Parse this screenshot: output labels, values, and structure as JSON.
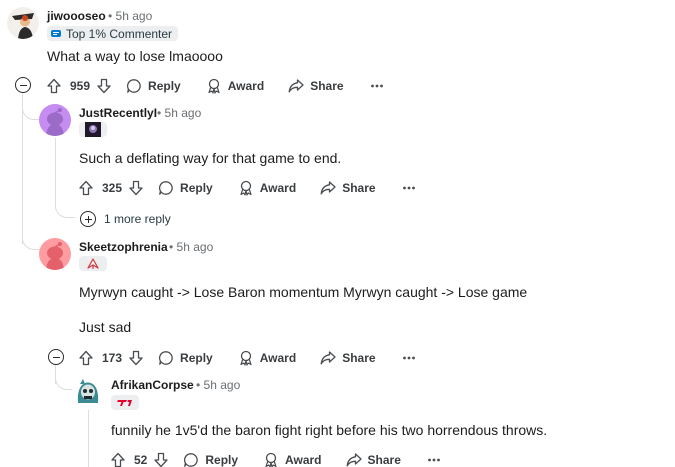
{
  "comments": [
    {
      "username": "jiwoooseo",
      "time": "5h ago",
      "flair": "Top 1% Commenter",
      "body": "What a way to lose lmaoooo",
      "votes": "959",
      "reply_label": "Reply",
      "award_label": "Award",
      "share_label": "Share"
    },
    {
      "username": "JustRecentlyI",
      "time": "5h ago",
      "body": "Such a deflating way for that game to end.",
      "votes": "325",
      "reply_label": "Reply",
      "award_label": "Award",
      "share_label": "Share",
      "more_replies": "1 more reply"
    },
    {
      "username": "Skeetzophrenia",
      "time": "5h ago",
      "body_lines": [
        "Myrwyn caught -> Lose Baron momentum Myrwyn caught -> Lose game",
        "Just sad"
      ],
      "votes": "173",
      "reply_label": "Reply",
      "award_label": "Award",
      "share_label": "Share"
    },
    {
      "username": "AfrikanCorpse",
      "time": "5h ago",
      "body": "funnily he 1v5'd the baron fight right before his two horrendous throws.",
      "votes": "52",
      "reply_label": "Reply",
      "award_label": "Award",
      "share_label": "Share"
    }
  ],
  "separator": "•",
  "colors": {
    "accent_flair": "#0079d3",
    "thread_line": "#dcdde0",
    "t1_red": "#e2012d"
  },
  "icons": [
    "upvote-icon",
    "downvote-icon",
    "comment-icon",
    "award-icon",
    "share-icon",
    "more-icon",
    "collapse-icon",
    "expand-icon"
  ]
}
